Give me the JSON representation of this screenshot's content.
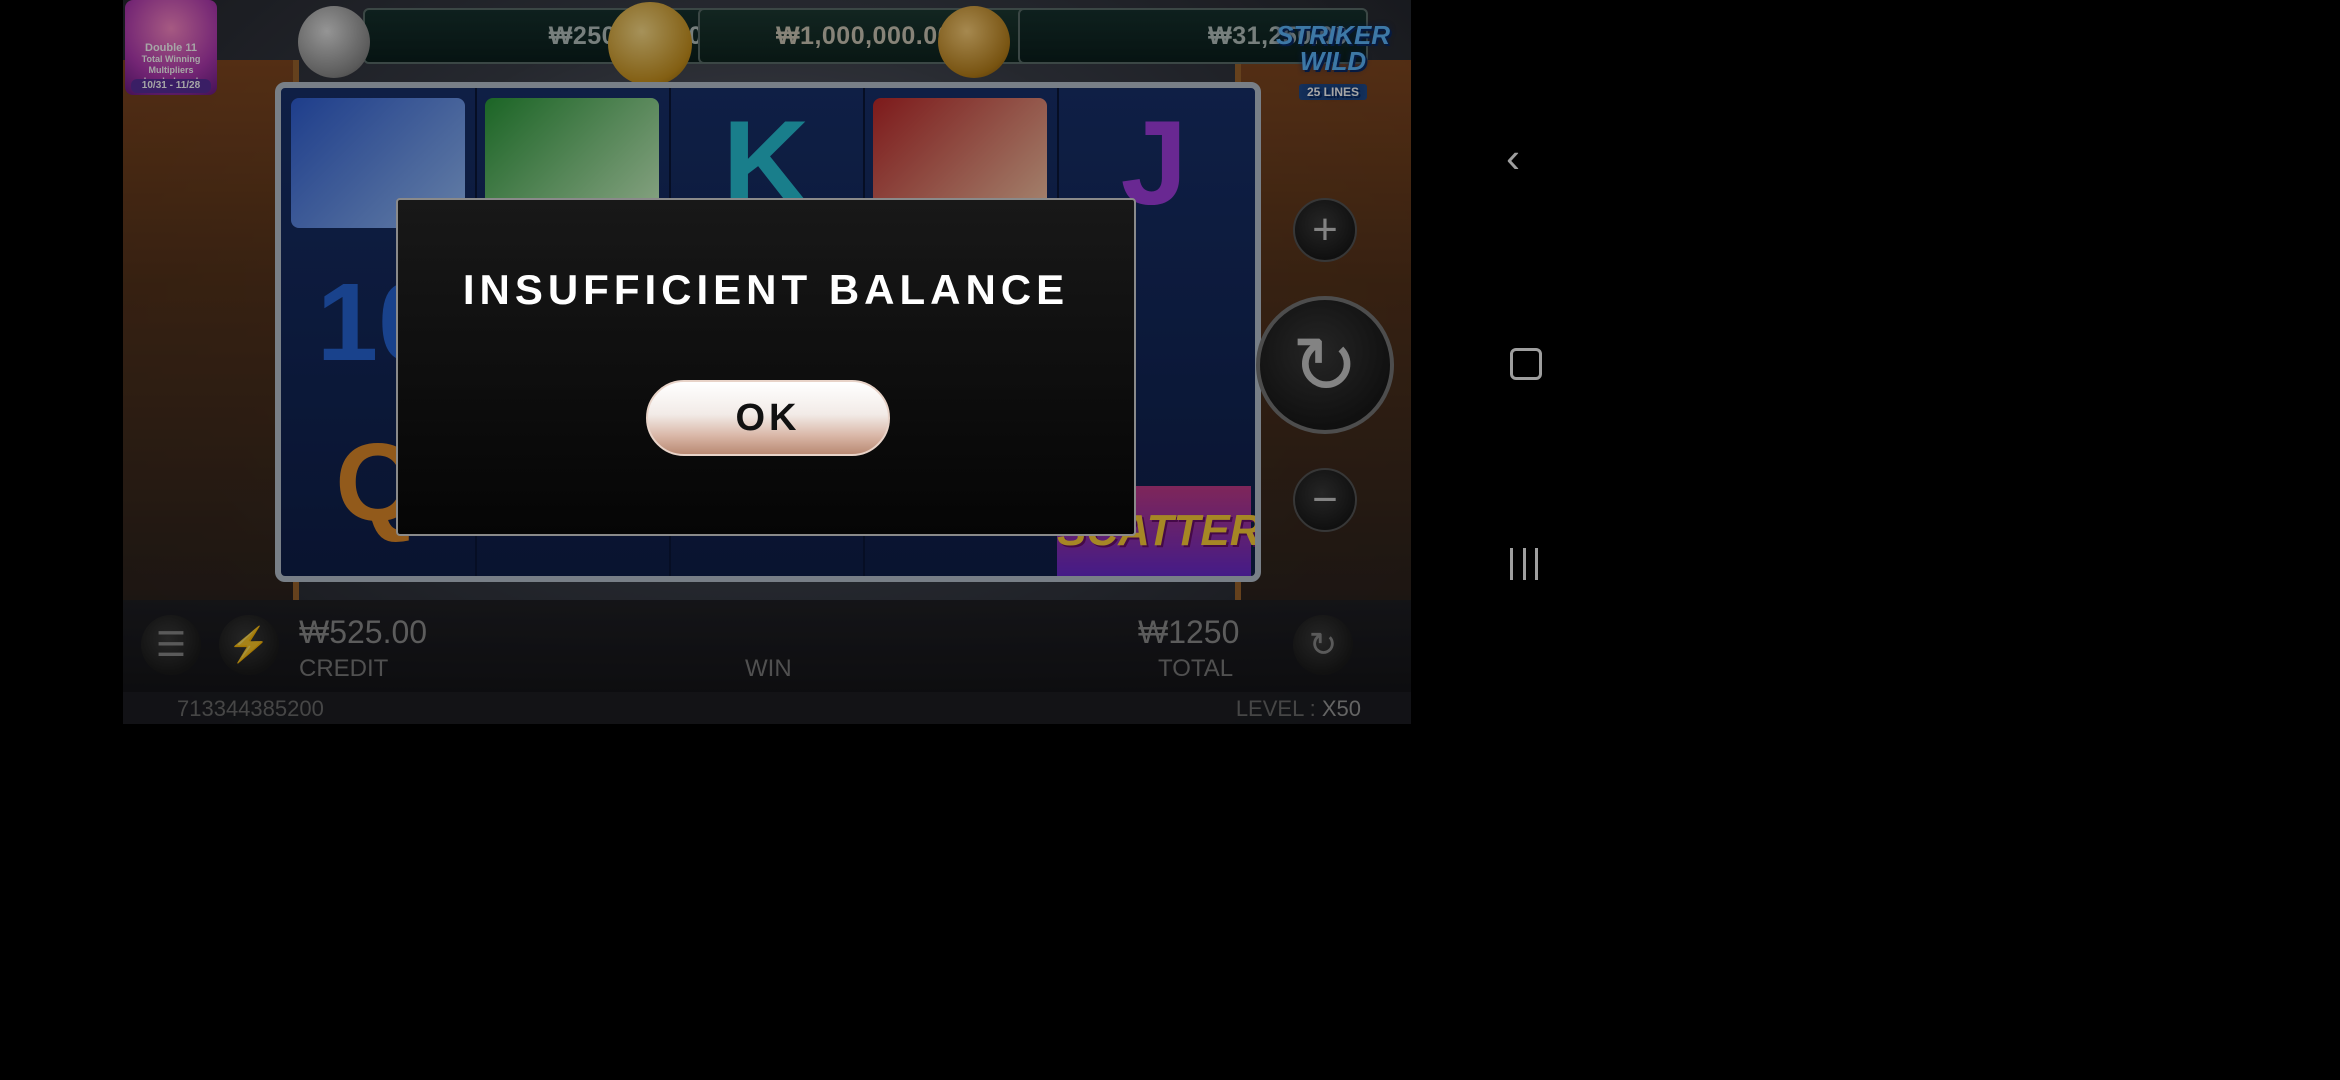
{
  "jackpots": {
    "left": "₩250,000.00",
    "middle": "₩1,000,000.00",
    "right": "₩31,250.00"
  },
  "event_badge": {
    "title": "Double 11",
    "line1": "Total Winning",
    "line2": "Multipliers Leaderboard",
    "dates": "10/31 - 11/28"
  },
  "logo": {
    "line1": "STRIKER",
    "line2": "WILD",
    "lines": "25 LINES"
  },
  "reels": {
    "symbols": [
      "K",
      "J",
      "10",
      "Q",
      "SCATTER"
    ]
  },
  "bottom_bar": {
    "credit_value": "₩525.00",
    "credit_label": "CREDIT",
    "win_label": "WIN",
    "total_value": "₩1250",
    "total_label": "TOTAL",
    "session_id": "713344385200",
    "level_label": "LEVEL :",
    "level_value": "X50"
  },
  "modal": {
    "title": "INSUFFICIENT BALANCE",
    "ok_label": "OK"
  },
  "icons": {
    "menu": "menu-icon",
    "turbo": "lightning-icon",
    "autoplay": "autoplay-icon",
    "plus": "plus-icon",
    "minus": "minus-icon",
    "spin": "spin-icon",
    "back": "back-icon",
    "home": "home-icon",
    "recents": "recents-icon"
  }
}
